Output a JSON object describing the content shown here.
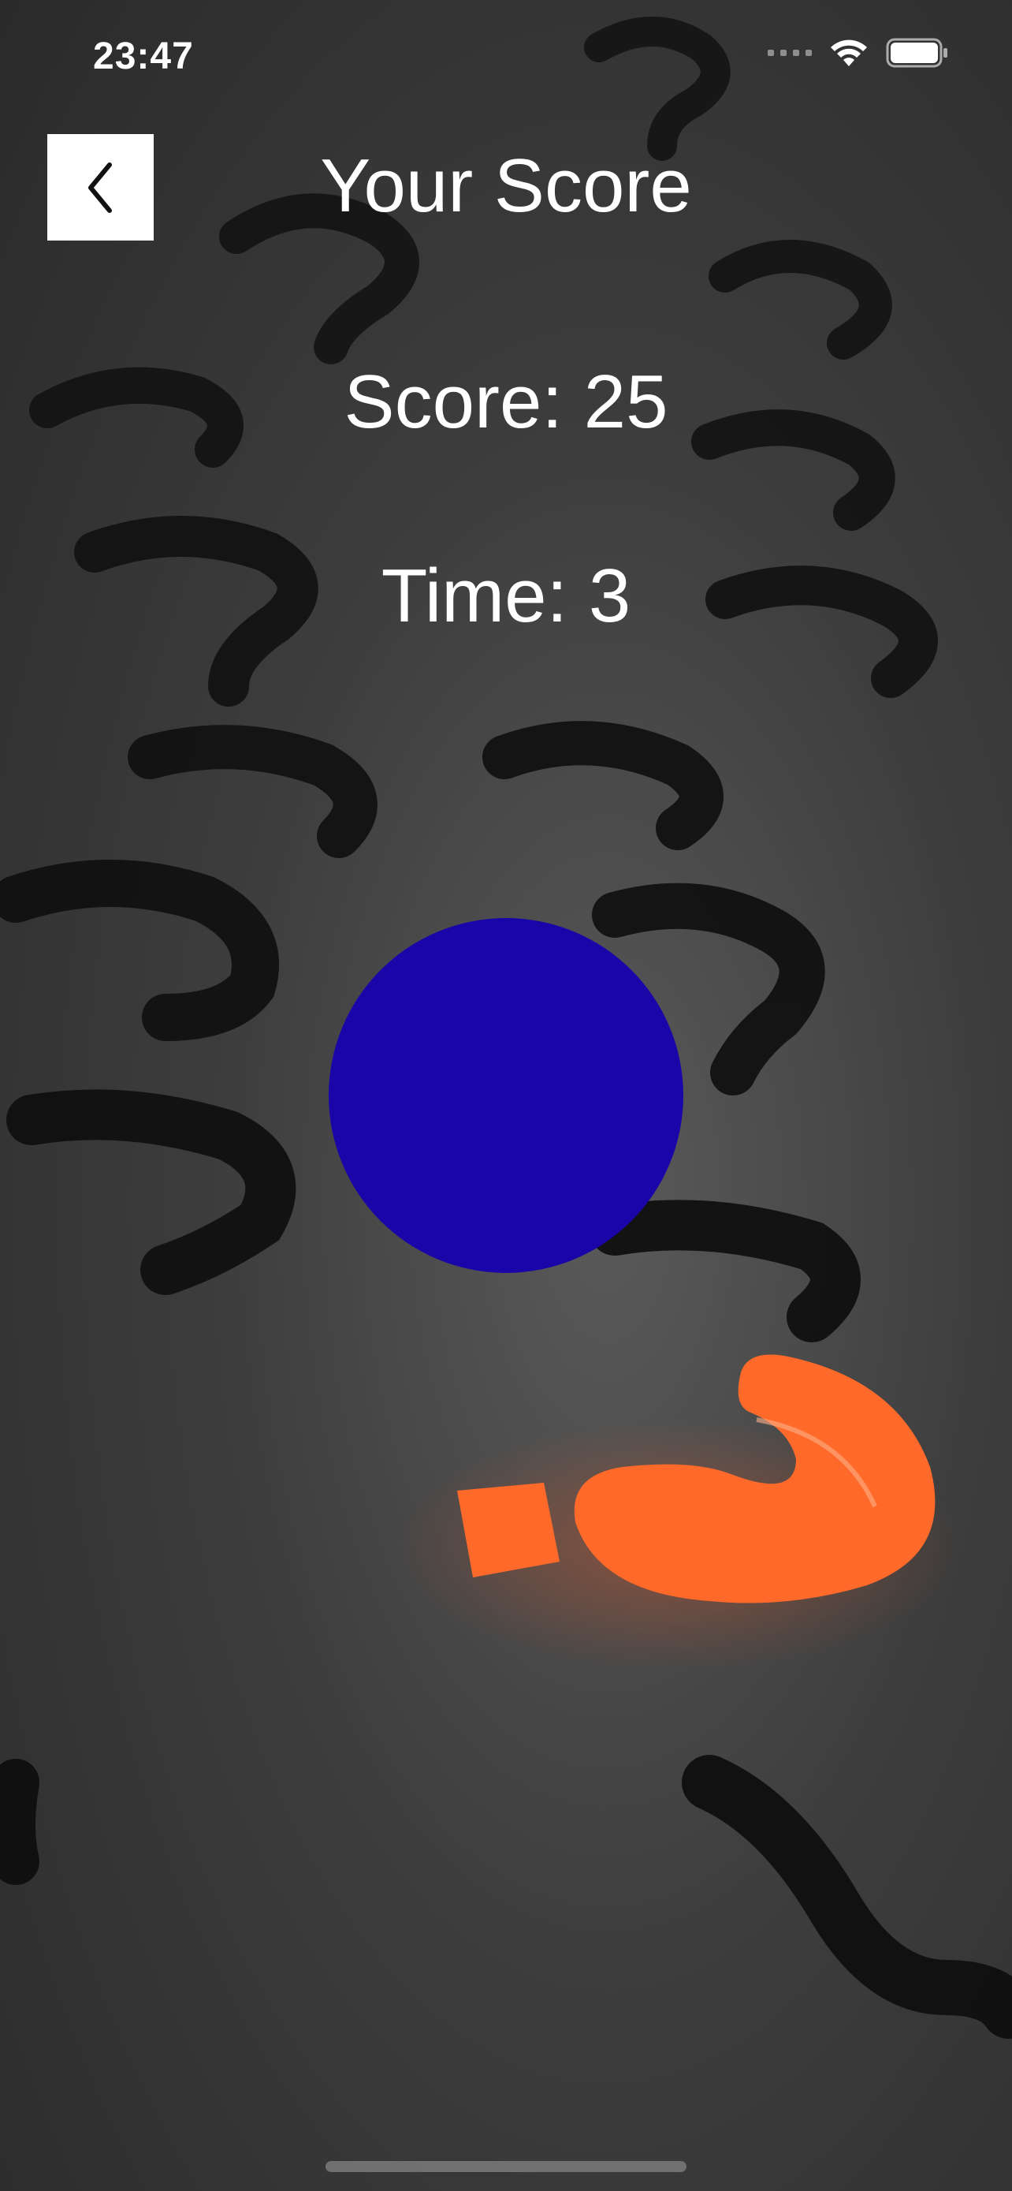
{
  "status_bar": {
    "time": "23:47",
    "wifi_icon": "wifi-icon",
    "battery_icon": "battery-icon",
    "signal_icon": "signal-dots-icon"
  },
  "header": {
    "back_icon": "chevron-left-icon",
    "title": "Your Score"
  },
  "game": {
    "score_label": "Score: 25",
    "time_label": "Time: 3",
    "target_color": "#1a06a8"
  },
  "background": {
    "description_icon": "question-marks-background",
    "accent_color": "#ff6a2a"
  }
}
